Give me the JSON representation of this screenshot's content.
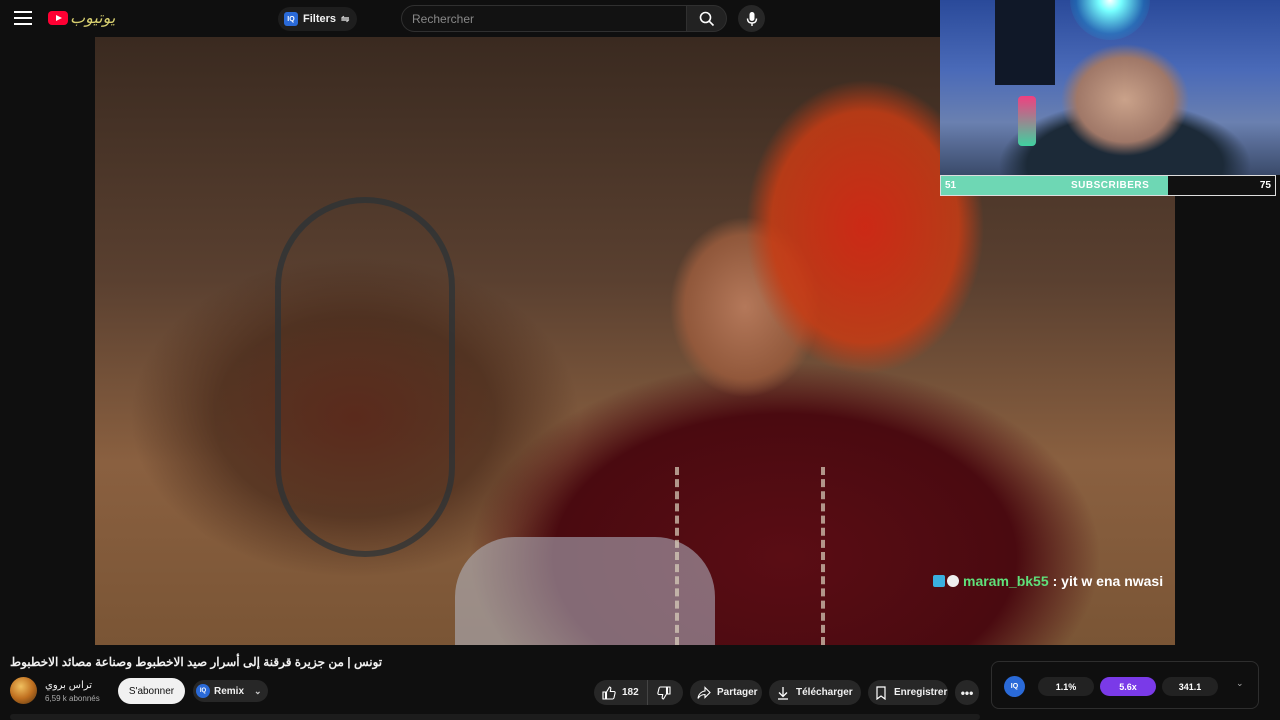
{
  "header": {
    "filters_label": "Filters",
    "iq_badge": "IQ",
    "search_placeholder": "Rechercher",
    "icons": [
      "menu-icon",
      "youtube-logo-icon",
      "tune-icon",
      "search-icon",
      "mic-icon"
    ]
  },
  "stream_overlay": {
    "subscribers": {
      "current": "51",
      "label": "SUBSCRIBERS",
      "goal": "75",
      "progress": 0.68
    },
    "chat": {
      "user": "maram_bk55",
      "message": ": yit w ena nwasi"
    }
  },
  "video": {
    "title": "تونس | من جزيرة قرقنة إلى أسرار صيد الاخطبوط وصناعة مصائد الاخطبوط"
  },
  "channel": {
    "name": "تراس بروي",
    "subscribers": "6,59 k abonnés",
    "subscribe_label": "S'abonner",
    "remix_label": "Remix",
    "remix_badge": "IQ"
  },
  "actions": {
    "like_count": "182",
    "share_label": "Partager",
    "download_label": "Télécharger",
    "save_label": "Enregistrer",
    "more_label": "•••"
  },
  "stats_panel": {
    "logo": "IQ",
    "values": [
      "1.1%",
      "5.6x",
      "341.1"
    ],
    "accent": "#7a3ae8"
  },
  "colors": {
    "background": "#0f0f0f",
    "youtube_red": "#ff0033",
    "subscriber_fill": "#6ed7b4",
    "chat_user": "#5fe07a",
    "iq_blue": "#2a6ad8"
  }
}
